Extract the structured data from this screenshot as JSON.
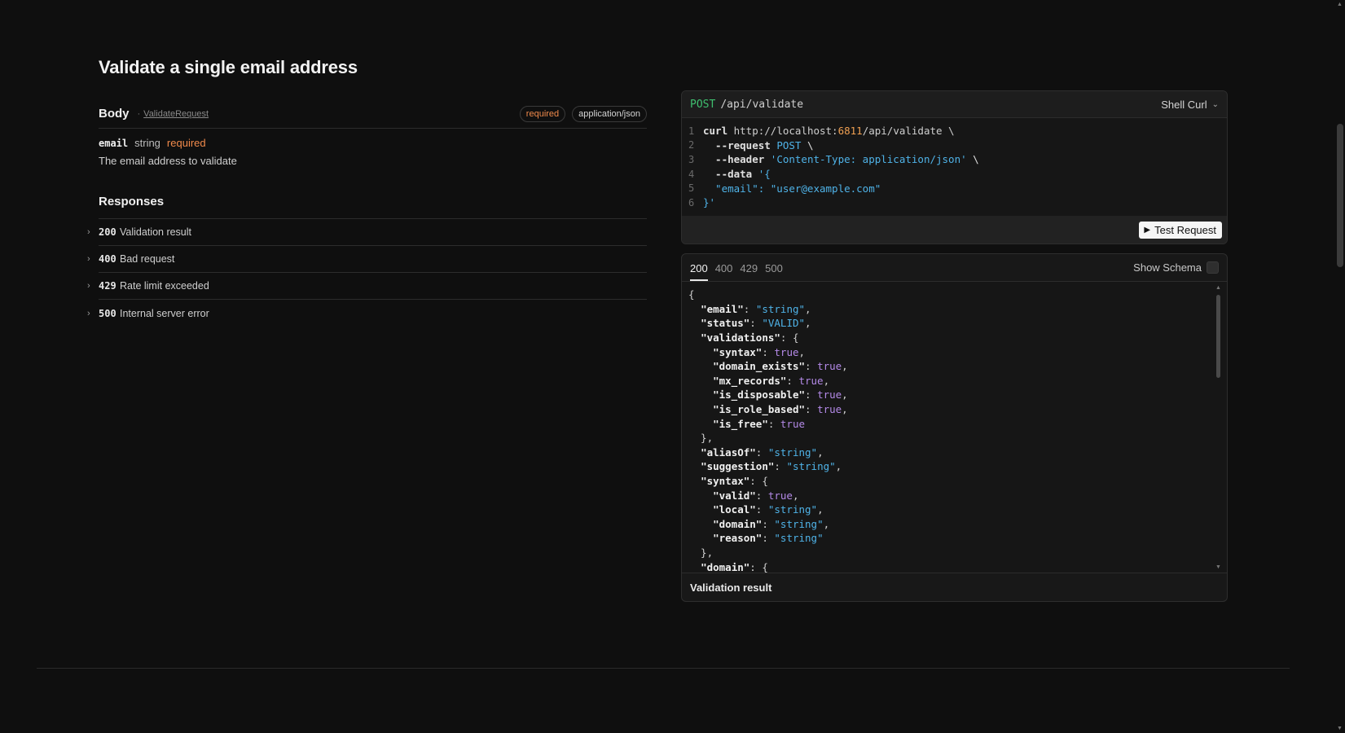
{
  "page": {
    "title": "Validate a single email address"
  },
  "body": {
    "label": "Body",
    "separator": "·",
    "schema_ref": "ValidateRequest",
    "badge_required": "required",
    "badge_content_type": "application/json",
    "field": {
      "name": "email",
      "type": "string",
      "required": "required",
      "description": "The email address to validate"
    }
  },
  "responses": {
    "title": "Responses",
    "items": [
      {
        "code": "200",
        "desc": "Validation result"
      },
      {
        "code": "400",
        "desc": "Bad request"
      },
      {
        "code": "429",
        "desc": "Rate limit exceeded"
      },
      {
        "code": "500",
        "desc": "Internal server error"
      }
    ]
  },
  "request": {
    "method": "POST",
    "path": "/api/validate",
    "language": "Shell Curl",
    "lines": [
      [
        {
          "t": "curl",
          "c": "kw"
        },
        {
          "t": " http://localhost:",
          "c": "url"
        },
        {
          "t": "6811",
          "c": "num"
        },
        {
          "t": "/api/validate \\",
          "c": "url"
        }
      ],
      [
        {
          "t": "  --request ",
          "c": "kw"
        },
        {
          "t": "POST",
          "c": "str"
        },
        {
          "t": " \\",
          "c": "plain"
        }
      ],
      [
        {
          "t": "  --header ",
          "c": "kw"
        },
        {
          "t": "'Content-Type: application/json'",
          "c": "str"
        },
        {
          "t": " \\",
          "c": "plain"
        }
      ],
      [
        {
          "t": "  --data ",
          "c": "kw"
        },
        {
          "t": "'{",
          "c": "str"
        }
      ],
      [
        {
          "t": "  \"email\": \"user@example.com\"",
          "c": "str"
        }
      ],
      [
        {
          "t": "}'",
          "c": "str"
        }
      ]
    ],
    "test_button": "Test Request"
  },
  "response_panel": {
    "tabs": [
      "200",
      "400",
      "429",
      "500"
    ],
    "active_tab": "200",
    "show_schema_label": "Show Schema",
    "footer": "Validation result",
    "json_lines": [
      [
        {
          "t": "{",
          "c": "p"
        }
      ],
      [
        {
          "t": "  ",
          "c": "p"
        },
        {
          "t": "\"email\"",
          "c": "k"
        },
        {
          "t": ": ",
          "c": "p"
        },
        {
          "t": "\"string\"",
          "c": "s"
        },
        {
          "t": ",",
          "c": "p"
        }
      ],
      [
        {
          "t": "  ",
          "c": "p"
        },
        {
          "t": "\"status\"",
          "c": "k"
        },
        {
          "t": ": ",
          "c": "p"
        },
        {
          "t": "\"VALID\"",
          "c": "s"
        },
        {
          "t": ",",
          "c": "p"
        }
      ],
      [
        {
          "t": "  ",
          "c": "p"
        },
        {
          "t": "\"validations\"",
          "c": "k"
        },
        {
          "t": ": {",
          "c": "p"
        }
      ],
      [
        {
          "t": "    ",
          "c": "p"
        },
        {
          "t": "\"syntax\"",
          "c": "k"
        },
        {
          "t": ": ",
          "c": "p"
        },
        {
          "t": "true",
          "c": "b"
        },
        {
          "t": ",",
          "c": "p"
        }
      ],
      [
        {
          "t": "    ",
          "c": "p"
        },
        {
          "t": "\"domain_exists\"",
          "c": "k"
        },
        {
          "t": ": ",
          "c": "p"
        },
        {
          "t": "true",
          "c": "b"
        },
        {
          "t": ",",
          "c": "p"
        }
      ],
      [
        {
          "t": "    ",
          "c": "p"
        },
        {
          "t": "\"mx_records\"",
          "c": "k"
        },
        {
          "t": ": ",
          "c": "p"
        },
        {
          "t": "true",
          "c": "b"
        },
        {
          "t": ",",
          "c": "p"
        }
      ],
      [
        {
          "t": "    ",
          "c": "p"
        },
        {
          "t": "\"is_disposable\"",
          "c": "k"
        },
        {
          "t": ": ",
          "c": "p"
        },
        {
          "t": "true",
          "c": "b"
        },
        {
          "t": ",",
          "c": "p"
        }
      ],
      [
        {
          "t": "    ",
          "c": "p"
        },
        {
          "t": "\"is_role_based\"",
          "c": "k"
        },
        {
          "t": ": ",
          "c": "p"
        },
        {
          "t": "true",
          "c": "b"
        },
        {
          "t": ",",
          "c": "p"
        }
      ],
      [
        {
          "t": "    ",
          "c": "p"
        },
        {
          "t": "\"is_free\"",
          "c": "k"
        },
        {
          "t": ": ",
          "c": "p"
        },
        {
          "t": "true",
          "c": "b"
        }
      ],
      [
        {
          "t": "  },",
          "c": "p"
        }
      ],
      [
        {
          "t": "  ",
          "c": "p"
        },
        {
          "t": "\"aliasOf\"",
          "c": "k"
        },
        {
          "t": ": ",
          "c": "p"
        },
        {
          "t": "\"string\"",
          "c": "s"
        },
        {
          "t": ",",
          "c": "p"
        }
      ],
      [
        {
          "t": "  ",
          "c": "p"
        },
        {
          "t": "\"suggestion\"",
          "c": "k"
        },
        {
          "t": ": ",
          "c": "p"
        },
        {
          "t": "\"string\"",
          "c": "s"
        },
        {
          "t": ",",
          "c": "p"
        }
      ],
      [
        {
          "t": "  ",
          "c": "p"
        },
        {
          "t": "\"syntax\"",
          "c": "k"
        },
        {
          "t": ": {",
          "c": "p"
        }
      ],
      [
        {
          "t": "    ",
          "c": "p"
        },
        {
          "t": "\"valid\"",
          "c": "k"
        },
        {
          "t": ": ",
          "c": "p"
        },
        {
          "t": "true",
          "c": "b"
        },
        {
          "t": ",",
          "c": "p"
        }
      ],
      [
        {
          "t": "    ",
          "c": "p"
        },
        {
          "t": "\"local\"",
          "c": "k"
        },
        {
          "t": ": ",
          "c": "p"
        },
        {
          "t": "\"string\"",
          "c": "s"
        },
        {
          "t": ",",
          "c": "p"
        }
      ],
      [
        {
          "t": "    ",
          "c": "p"
        },
        {
          "t": "\"domain\"",
          "c": "k"
        },
        {
          "t": ": ",
          "c": "p"
        },
        {
          "t": "\"string\"",
          "c": "s"
        },
        {
          "t": ",",
          "c": "p"
        }
      ],
      [
        {
          "t": "    ",
          "c": "p"
        },
        {
          "t": "\"reason\"",
          "c": "k"
        },
        {
          "t": ": ",
          "c": "p"
        },
        {
          "t": "\"string\"",
          "c": "s"
        }
      ],
      [
        {
          "t": "  },",
          "c": "p"
        }
      ],
      [
        {
          "t": "  ",
          "c": "p"
        },
        {
          "t": "\"domain\"",
          "c": "k"
        },
        {
          "t": ": {",
          "c": "p"
        }
      ]
    ]
  },
  "icons": {
    "chevron_right": "›",
    "chevron_down": "⌄",
    "play": "▶",
    "scroll_up": "▲",
    "scroll_down": "▼"
  },
  "colors": {
    "background": "#0f0f0f",
    "method_post": "#3fbf6f",
    "required": "#f08a4b",
    "string": "#4fb3e8",
    "boolean": "#b48ae8",
    "number": "#f0a052"
  }
}
